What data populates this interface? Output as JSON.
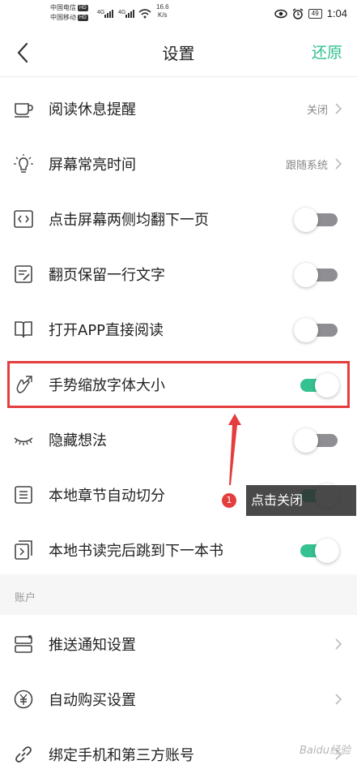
{
  "status_bar": {
    "carrier1": "中国电信",
    "carrier2": "中国移动",
    "hd": "HD",
    "signal": "4G",
    "speed_value": "16.6",
    "speed_unit": "K/s",
    "battery": "49",
    "time": "1:04"
  },
  "nav": {
    "title": "设置",
    "restore_label": "还原"
  },
  "rows": [
    {
      "label": "阅读休息提醒",
      "value": "关闭",
      "icon": "cup-icon"
    },
    {
      "label": "屏幕常亮时间",
      "value": "跟随系统",
      "icon": "bulb-icon"
    },
    {
      "label": "点击屏幕两侧均翻下一页",
      "toggle": "off",
      "icon": "code-box-icon"
    },
    {
      "label": "翻页保留一行文字",
      "toggle": "off",
      "icon": "note-edit-icon"
    },
    {
      "label": "打开APP直接阅读",
      "toggle": "off",
      "icon": "book-open-icon"
    },
    {
      "label": "手势缩放字体大小",
      "toggle": "on",
      "icon": "gesture-zoom-icon"
    },
    {
      "label": "隐藏想法",
      "toggle": "off",
      "icon": "eye-closed-icon"
    },
    {
      "label": "本地章节自动切分",
      "toggle": "on",
      "icon": "list-box-icon"
    },
    {
      "label": "本地书读完后跳到下一本书",
      "toggle": "on",
      "icon": "next-book-icon"
    }
  ],
  "section_account": "账户",
  "account_rows": [
    {
      "label": "推送通知设置",
      "icon": "push-icon"
    },
    {
      "label": "自动购买设置",
      "icon": "yuan-icon"
    },
    {
      "label": "绑定手机和第三方账号",
      "icon": "link-icon"
    }
  ],
  "annotation": {
    "badge": "1",
    "tip": "点击关闭"
  },
  "watermark": "Baidu经验",
  "colors": {
    "accent": "#35c190",
    "highlight": "#e43d3d"
  }
}
